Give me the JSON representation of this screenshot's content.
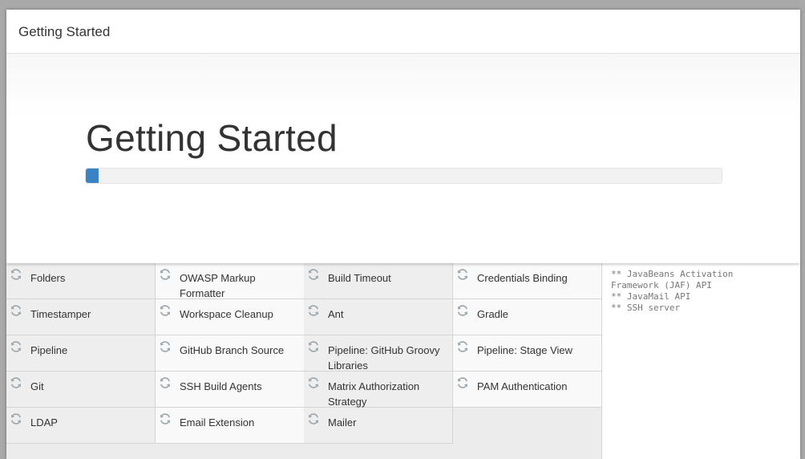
{
  "window": {
    "title": "Getting Started"
  },
  "hero": {
    "title": "Getting Started",
    "progress_fraction": 0.02,
    "accent_color": "#3a82c4"
  },
  "plugins": [
    {
      "label": "Folders",
      "icon": "refresh-icon"
    },
    {
      "label": "OWASP Markup Formatter",
      "icon": "refresh-icon"
    },
    {
      "label": "Build Timeout",
      "icon": "refresh-icon"
    },
    {
      "label": "Credentials Binding",
      "icon": "refresh-icon"
    },
    {
      "label": "Timestamper",
      "icon": "refresh-icon"
    },
    {
      "label": "Workspace Cleanup",
      "icon": "refresh-icon"
    },
    {
      "label": "Ant",
      "icon": "refresh-icon"
    },
    {
      "label": "Gradle",
      "icon": "refresh-icon"
    },
    {
      "label": "Pipeline",
      "icon": "refresh-icon"
    },
    {
      "label": "GitHub Branch Source",
      "icon": "refresh-icon"
    },
    {
      "label": "Pipeline: GitHub Groovy Libraries",
      "icon": "refresh-icon"
    },
    {
      "label": "Pipeline: Stage View",
      "icon": "refresh-icon"
    },
    {
      "label": "Git",
      "icon": "refresh-icon"
    },
    {
      "label": "SSH Build Agents",
      "icon": "refresh-icon"
    },
    {
      "label": "Matrix Authorization Strategy",
      "icon": "refresh-icon"
    },
    {
      "label": "PAM Authentication",
      "icon": "refresh-icon"
    },
    {
      "label": "LDAP",
      "icon": "refresh-icon"
    },
    {
      "label": "Email Extension",
      "icon": "refresh-icon"
    },
    {
      "label": "Mailer",
      "icon": "refresh-icon"
    }
  ],
  "log": {
    "lines": [
      "** JavaBeans Activation",
      "Framework (JAF) API",
      "** JavaMail API",
      "** SSH server"
    ]
  }
}
